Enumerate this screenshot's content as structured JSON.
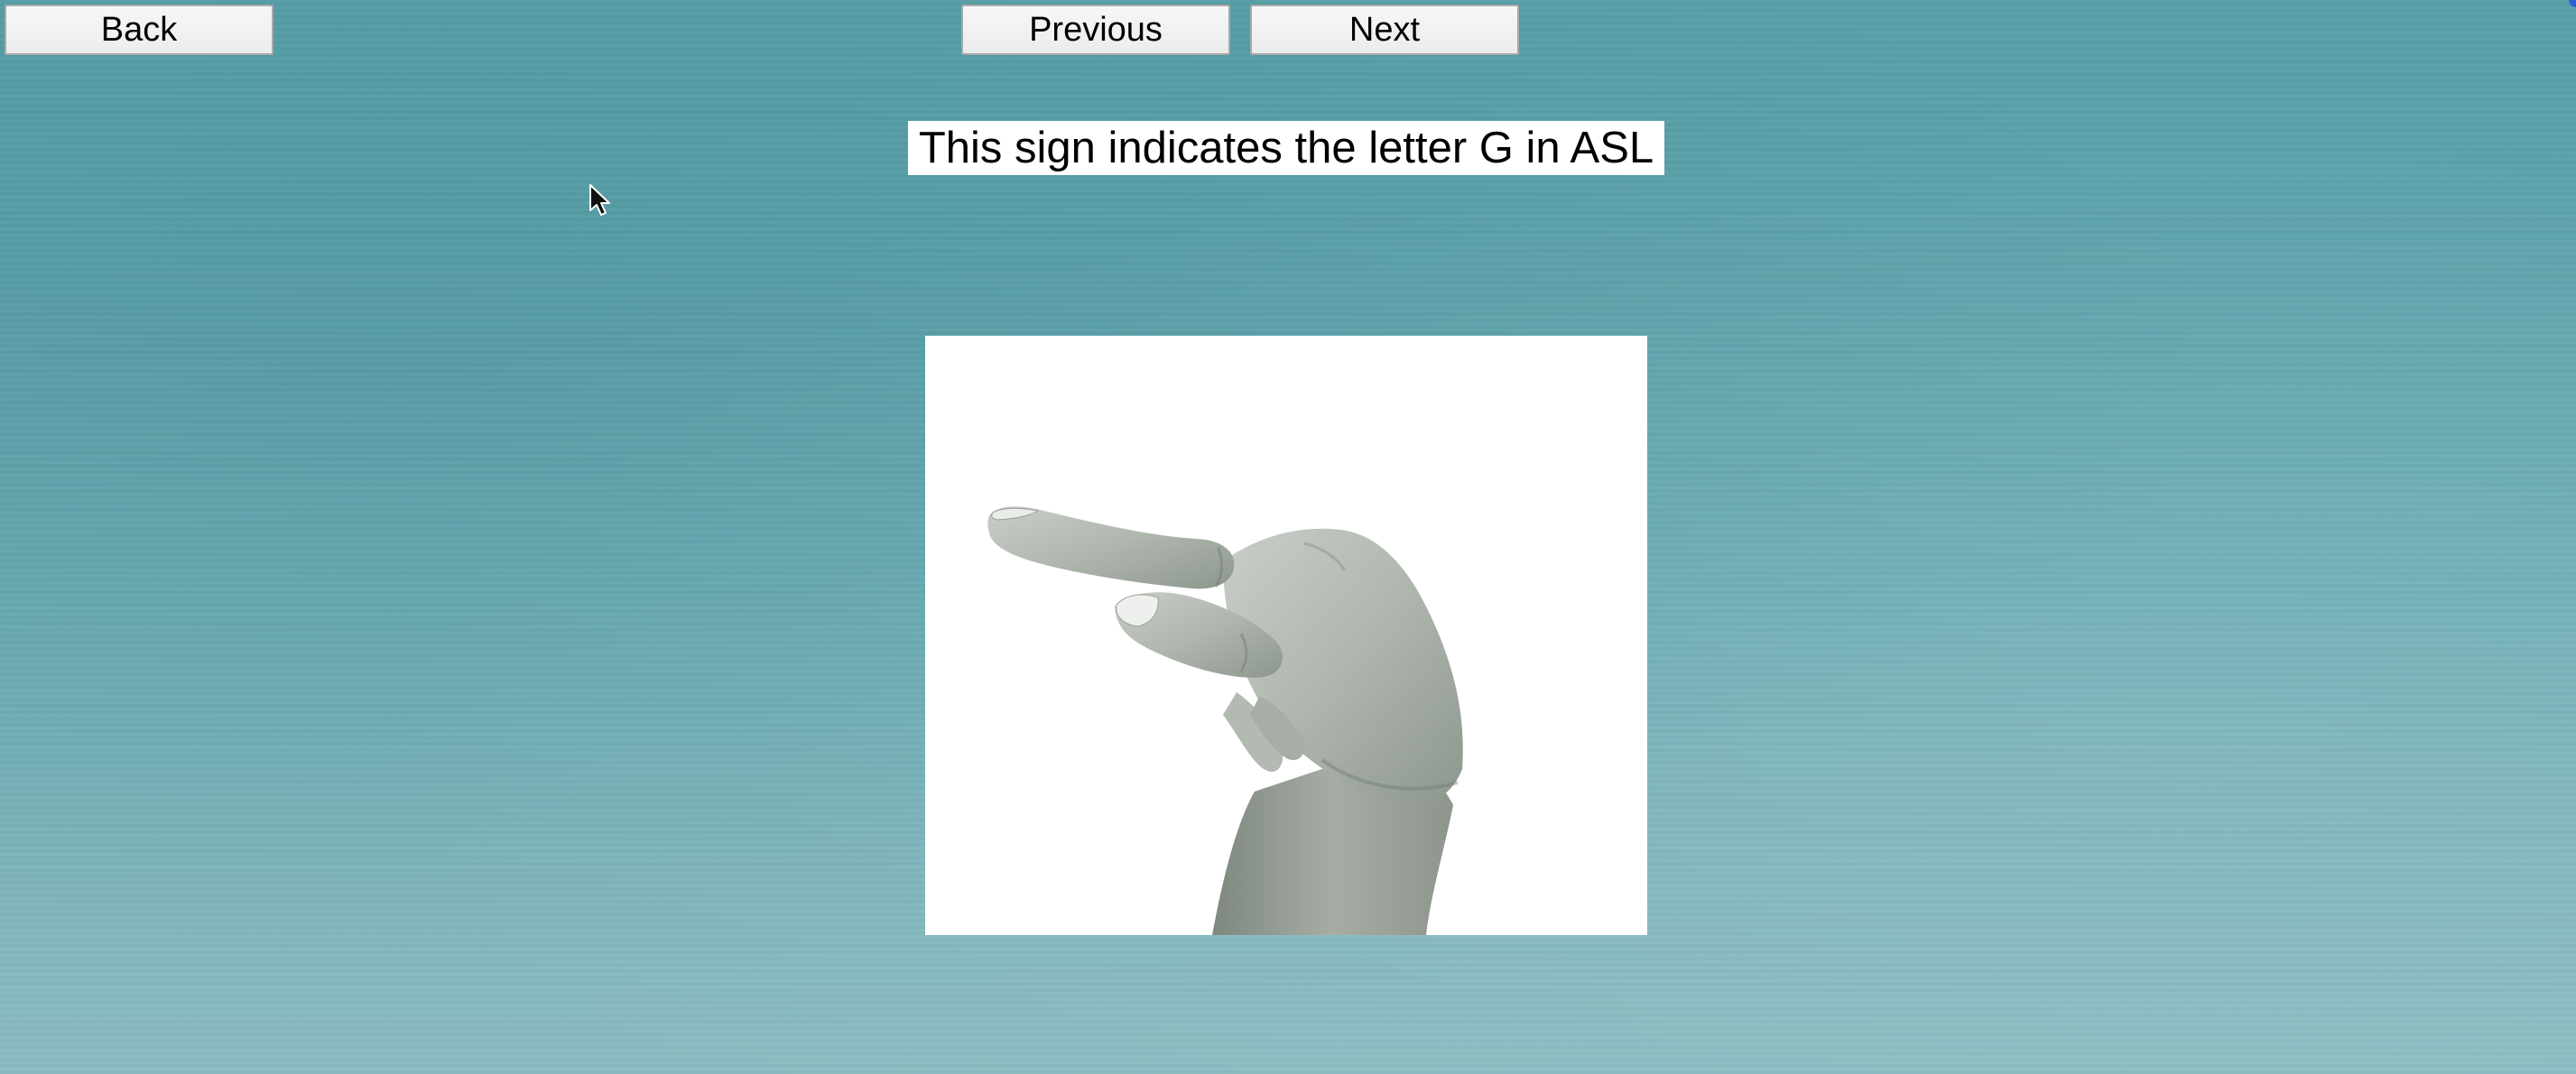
{
  "nav": {
    "back_label": "Back",
    "previous_label": "Previous",
    "next_label": "Next"
  },
  "caption": "This sign indicates the letter G in ASL",
  "image": {
    "depicts": "hand-sign-g",
    "background": "#ffffff"
  },
  "colors": {
    "background_top": "#58a0a9",
    "background_bottom": "#8cbcc2",
    "button_face": "#efefef",
    "button_border": "#a9a9a9"
  }
}
